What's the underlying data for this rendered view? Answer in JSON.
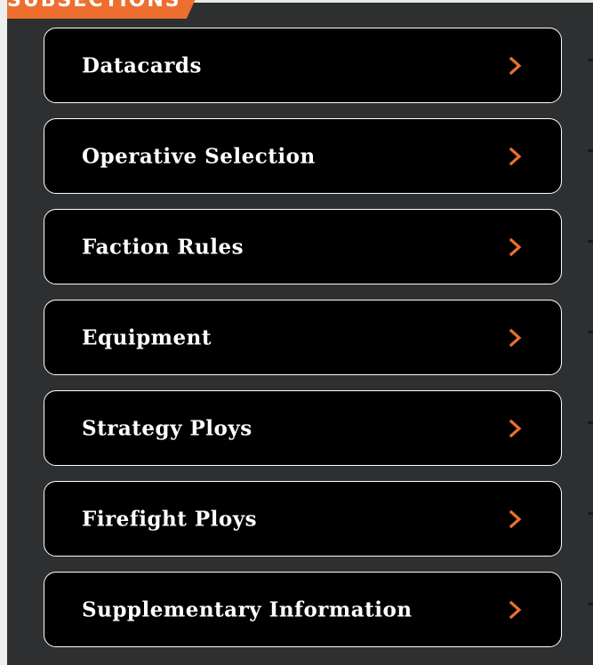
{
  "section_header": {
    "label": "SUBSECTIONS"
  },
  "nav": {
    "items": [
      {
        "label": "Datacards"
      },
      {
        "label": "Operative Selection"
      },
      {
        "label": "Faction Rules"
      },
      {
        "label": "Equipment"
      },
      {
        "label": "Strategy Ploys"
      },
      {
        "label": "Firefight Ploys"
      },
      {
        "label": "Supplementary Information"
      }
    ]
  },
  "colors": {
    "accent": "#ed6e2e",
    "panel_background": "#2d2f30",
    "item_background": "#000000",
    "item_border": "#ffffff"
  },
  "icons": {
    "item_chevron": "chevron-right-icon"
  }
}
